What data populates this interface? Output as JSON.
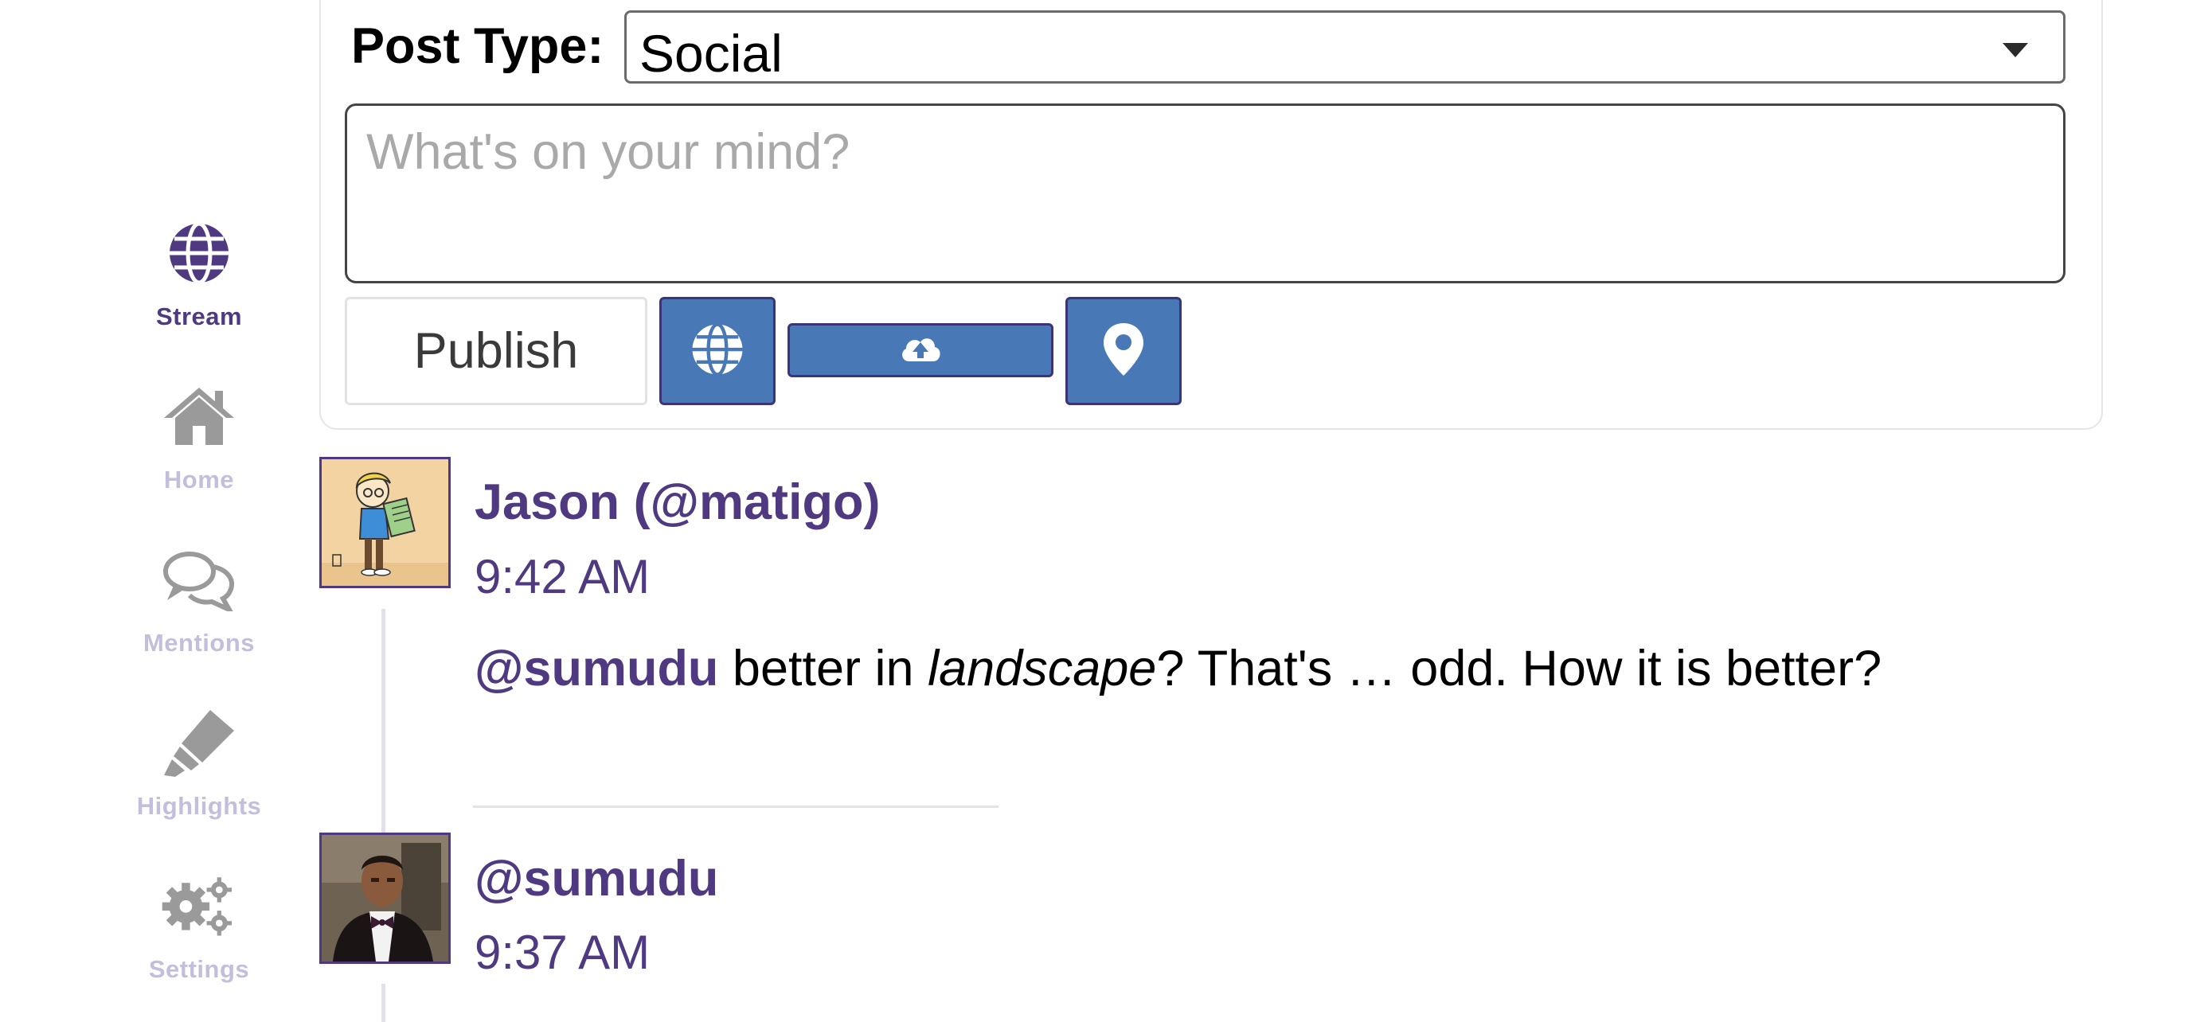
{
  "sidebar": {
    "items": [
      {
        "label": "Stream",
        "icon": "globe-icon",
        "active": true
      },
      {
        "label": "Home",
        "icon": "home-icon",
        "active": false
      },
      {
        "label": "Mentions",
        "icon": "comments-icon",
        "active": false
      },
      {
        "label": "Highlights",
        "icon": "highlighter-icon",
        "active": false
      },
      {
        "label": "Settings",
        "icon": "gears-icon",
        "active": false
      }
    ]
  },
  "composer": {
    "post_type_label": "Post Type:",
    "post_type_value": "Social",
    "placeholder": "What's on your mind?",
    "publish_label": "Publish",
    "buttons": [
      "globe-icon",
      "cloud-upload-icon",
      "map-pin-icon"
    ]
  },
  "posts": [
    {
      "author": "Jason (@matigo)",
      "time": "9:42 AM",
      "body": {
        "mention": "@sumudu",
        "text_before_em": " better in ",
        "em": "landscape",
        "text_after_em": "? That's … odd. How it is better?"
      }
    },
    {
      "author": "@sumudu",
      "time": "9:37 AM"
    }
  ],
  "colors": {
    "accent": "#4f3a82",
    "button_blue": "#4878b6",
    "inactive_nav": "#c3bedb",
    "inactive_icon": "#9a9a9a"
  }
}
